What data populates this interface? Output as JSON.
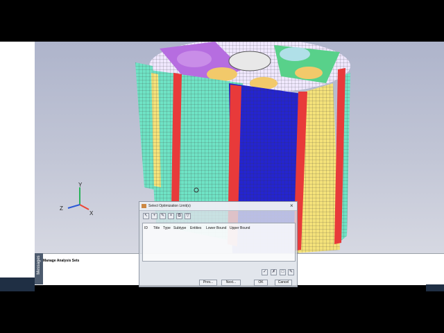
{
  "dialog": {
    "title": "Select Optimization Limit(s)",
    "close_glyph": "×",
    "toolbar_icons": [
      "select-icon",
      "add-icon",
      "edit-icon",
      "delete-icon",
      "copy-icon",
      "filter-icon"
    ],
    "columns": [
      "ID",
      "Title",
      "Type",
      "Subtype",
      "Entities",
      "Lower Bound",
      "Upper Bound"
    ],
    "side_icons": [
      "check-icon",
      "uncheck-icon",
      "new-icon",
      "pencil-icon"
    ],
    "buttons": {
      "prev": "Prev...",
      "next": "Next...",
      "ok": "OK",
      "cancel": "Cancel"
    }
  },
  "message_panel": {
    "tab_label": "Messages",
    "text": "Manage Analysis Sets"
  },
  "axes": {
    "x": "X",
    "y": "Y",
    "z": "Z"
  },
  "colors": {
    "viewport_bg": "#b9bdcf",
    "mesh_cyan": "#6fe3c5",
    "mesh_yellow": "#f2e37a",
    "mesh_blue": "#2a2ad8",
    "mesh_red": "#e83a3a",
    "mesh_purple": "#9b5ad6"
  }
}
